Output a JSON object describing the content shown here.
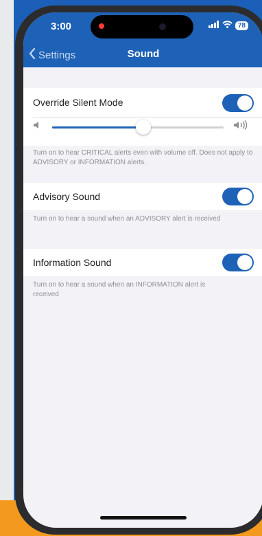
{
  "status": {
    "time": "3:00",
    "battery": "78"
  },
  "nav": {
    "back_label": "Settings",
    "title": "Sound"
  },
  "settings": {
    "override": {
      "label": "Override Silent Mode",
      "enabled": true,
      "volume_level": 0.53,
      "description": "Turn on to hear CRITICAL alerts even with volume off. Does not apply to ADVISORY or INFORMATION alerts."
    },
    "advisory": {
      "label": "Advisory Sound",
      "enabled": true,
      "description": "Turn on to hear a sound when an ADVISORY alert is received"
    },
    "information": {
      "label": "Information Sound",
      "enabled": true,
      "description": "Turn on to hear a sound when an INFORMATION alert is received"
    }
  },
  "colors": {
    "accent": "#1e62b7",
    "background": "#f2f2f7"
  },
  "icons": [
    "chevron-left-icon",
    "signal-icon",
    "wifi-icon",
    "battery-icon",
    "volume-low-icon",
    "volume-high-icon"
  ]
}
